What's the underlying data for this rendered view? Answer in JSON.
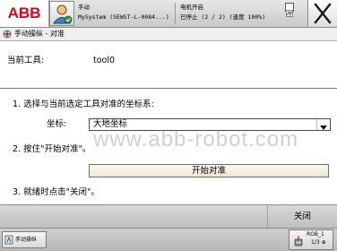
{
  "header": {
    "logo": "ABB",
    "mode": "手动",
    "system": "MySystem (SEWST-L-0084...)",
    "motor_status": "电机开启",
    "run_status": "已停止 (2 / 2) (速度 100%)"
  },
  "titlebar": {
    "title": "手动操纵 - 对准"
  },
  "content": {
    "current_tool_label": "当前工具:",
    "current_tool_value": "tool0",
    "step1": "1.  选择与当前选定工具对准的坐标系:",
    "coord_label": "坐标:",
    "coord_value": "大地坐标",
    "step2": "2.  按住\"开始对准\"。",
    "start_button": "开始对准",
    "step3": "3.  就绪时点击\"关闭\"。",
    "watermark": "www.abb-robot.com"
  },
  "commandbar": {
    "close_label": "关闭"
  },
  "taskbar": {
    "task_label": "手动操纵",
    "quickset_label": "ROB_1",
    "quickset_sub": "1/3 ⊕"
  },
  "colors": {
    "abb_red": "#e2001a",
    "button_bg": "#f1ecdc",
    "bar_gray": "#c9c9c9"
  }
}
